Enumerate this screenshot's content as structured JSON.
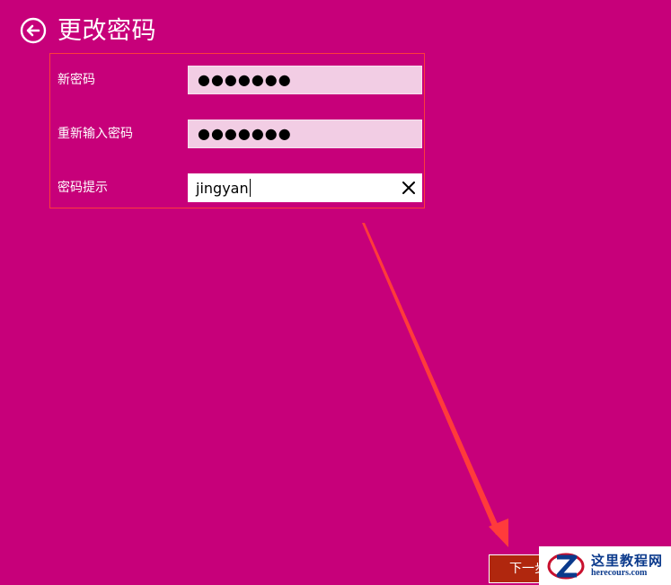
{
  "header": {
    "title": "更改密码",
    "back_icon": "back-arrow-circle-icon"
  },
  "form": {
    "new_password": {
      "label": "新密码",
      "masked_value": "●●●●●●●"
    },
    "confirm_password": {
      "label": "重新输入密码",
      "masked_value": "●●●●●●●"
    },
    "password_hint": {
      "label": "密码提示",
      "value": "jingyan",
      "clear_icon": "close-icon"
    }
  },
  "footer": {
    "next_label": "下一步"
  },
  "watermark": {
    "title": "这里教程网",
    "url": "herecours.com"
  },
  "colors": {
    "background": "#c7007a",
    "password_field": "#f2cde4",
    "next_button": "#b0270e",
    "highlight": "#ff3b3b"
  }
}
